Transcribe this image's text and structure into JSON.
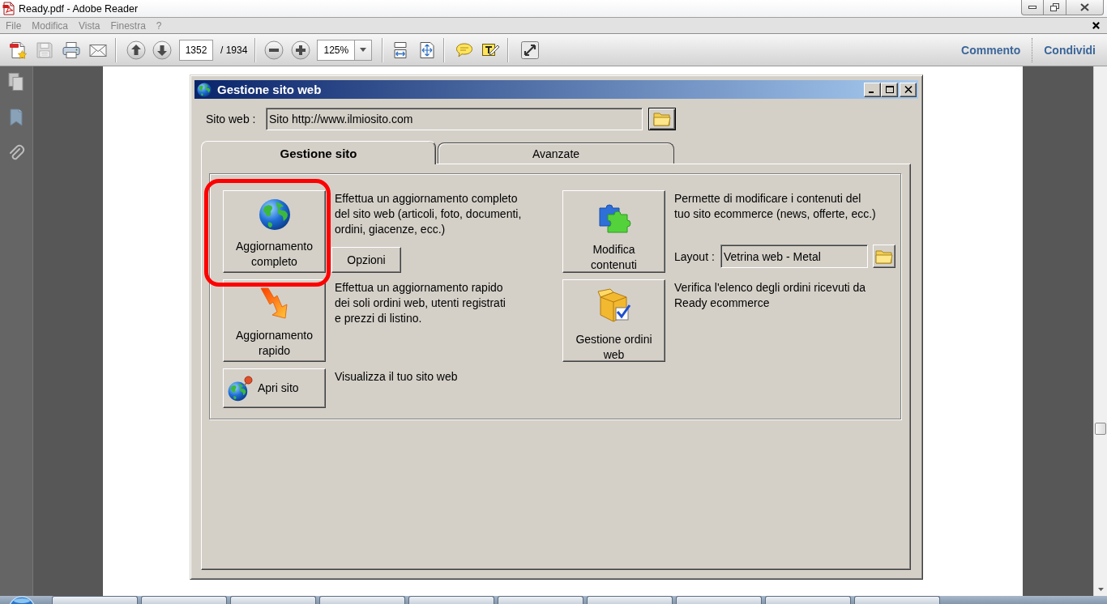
{
  "window": {
    "title": "Ready.pdf - Adobe Reader"
  },
  "menu_bar": {
    "items": [
      "File",
      "Modifica",
      "Vista",
      "Finestra",
      "?"
    ]
  },
  "toolbar": {
    "save_button": {
      "disabled": true
    },
    "page": {
      "value": "1352",
      "total": "/ 1934"
    },
    "zoom": {
      "value": "125%"
    },
    "links": [
      "Commento",
      "Condividi"
    ]
  },
  "dialog": {
    "title": "Gestione sito web",
    "site": {
      "label": "Sito web :",
      "value": "Sito http://www.ilmiosito.com"
    },
    "tabs": [
      {
        "label": "Gestione sito",
        "selected": true
      },
      {
        "label": "Avanzate",
        "selected": false
      }
    ],
    "columns": [
      {
        "actions": [
          {
            "kind": "large",
            "label": "Aggiornamento completo",
            "highlighted": true,
            "description": "Effettua un aggiornamento completo\ndel sito web (articoli, foto, documenti,\nordini, giacenze, ecc.)",
            "button": "Opzioni"
          },
          {
            "kind": "large",
            "label": "Aggiornamento rapido",
            "highlighted": false,
            "description": "Effettua un aggiornamento rapido\ndei soli ordini web, utenti registrati\ne prezzi di listino."
          },
          {
            "kind": "small",
            "label": "Apri sito",
            "highlighted": false,
            "description": "Visualizza il tuo sito web"
          }
        ]
      },
      {
        "actions": [
          {
            "kind": "large",
            "label": "Modifica contenuti",
            "highlighted": false,
            "description": "Permette di modificare i contenuti del\ntuo sito ecommerce (news, offerte, ecc.)",
            "field": {
              "label": "Layout :",
              "value": "Vetrina web - Metal"
            }
          },
          {
            "kind": "large",
            "label": "Gestione ordini web",
            "highlighted": false,
            "description": "Verifica l'elenco degli ordini ricevuti da\nReady ecommerce"
          }
        ]
      }
    ]
  }
}
